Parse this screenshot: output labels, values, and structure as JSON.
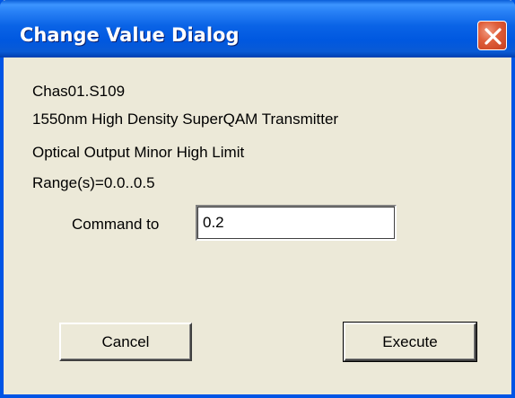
{
  "window": {
    "title": "Change Value Dialog",
    "close_icon": "close-x-icon",
    "colors": {
      "titlebar": "#0058e0",
      "close_button": "#d9532f",
      "background": "#ece9d8"
    }
  },
  "info": {
    "line1": "Chas01.S109",
    "line2": "1550nm High Density SuperQAM Transmitter",
    "line3": "Optical Output Minor High Limit",
    "line4": "Range(s)=0.0..0.5"
  },
  "command": {
    "label": "Command to",
    "value": "0.2"
  },
  "buttons": {
    "cancel": "Cancel",
    "execute": "Execute"
  }
}
